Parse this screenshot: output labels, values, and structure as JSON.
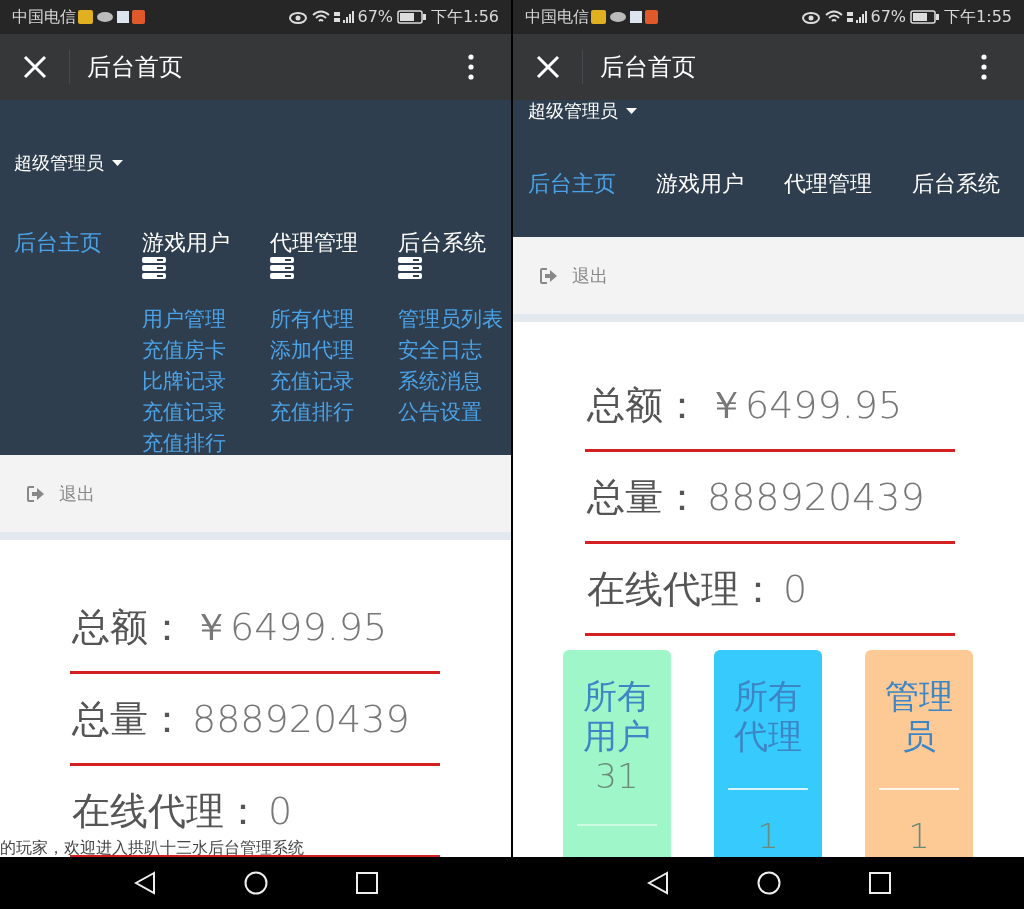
{
  "phones": [
    {
      "status_bar": {
        "carrier": "中国电信",
        "battery": "67%",
        "time": "下午1:56"
      },
      "title": "后台首页",
      "user_menu": "超级管理员",
      "nav": [
        {
          "label": "后台主页",
          "selected": true
        },
        {
          "label": "游戏用户",
          "selected": false,
          "children": [
            {
              "label": "用户管理"
            },
            {
              "label": "充值房卡"
            },
            {
              "label": "比牌记录"
            },
            {
              "label": "充值记录"
            },
            {
              "label": "充值排行"
            }
          ]
        },
        {
          "label": "代理管理",
          "selected": false,
          "children": [
            {
              "label": "所有代理"
            },
            {
              "label": "添加代理"
            },
            {
              "label": "充值记录"
            },
            {
              "label": "充值排行"
            }
          ]
        },
        {
          "label": "后台系统",
          "selected": false,
          "children": [
            {
              "label": "管理员列表"
            },
            {
              "label": "安全日志"
            },
            {
              "label": "系统消息"
            },
            {
              "label": "公告设置"
            }
          ]
        }
      ],
      "logout": "退出",
      "stats": [
        {
          "label": "总额：",
          "value": "￥6499.95"
        },
        {
          "label": "总量：",
          "value": "888920439"
        },
        {
          "label": "在线代理：",
          "value": "0"
        }
      ],
      "marquee": "的玩家，欢迎进入拱趴十三水后台管理系统"
    },
    {
      "status_bar": {
        "carrier": "中国电信",
        "battery": "67%",
        "time": "下午1:55"
      },
      "title": "后台首页",
      "user_menu": "超级管理员",
      "nav": [
        {
          "label": "后台主页",
          "selected": true
        },
        {
          "label": "游戏用户",
          "selected": false
        },
        {
          "label": "代理管理",
          "selected": false
        },
        {
          "label": "后台系统",
          "selected": false
        }
      ],
      "logout": "退出",
      "stats": [
        {
          "label": "总额：",
          "value": "￥6499.95"
        },
        {
          "label": "总量：",
          "value": "888920439"
        },
        {
          "label": "在线代理：",
          "value": "0"
        }
      ],
      "cards": [
        {
          "title": "所有用户",
          "value": "31",
          "kind": "count-above",
          "color": "#9ff7c9"
        },
        {
          "title": "所有代理",
          "value": "1",
          "kind": "count-below",
          "color": "#36cbfc"
        },
        {
          "title": "管理员",
          "value": "1",
          "kind": "count-below",
          "color": "#fdca96"
        }
      ]
    }
  ]
}
